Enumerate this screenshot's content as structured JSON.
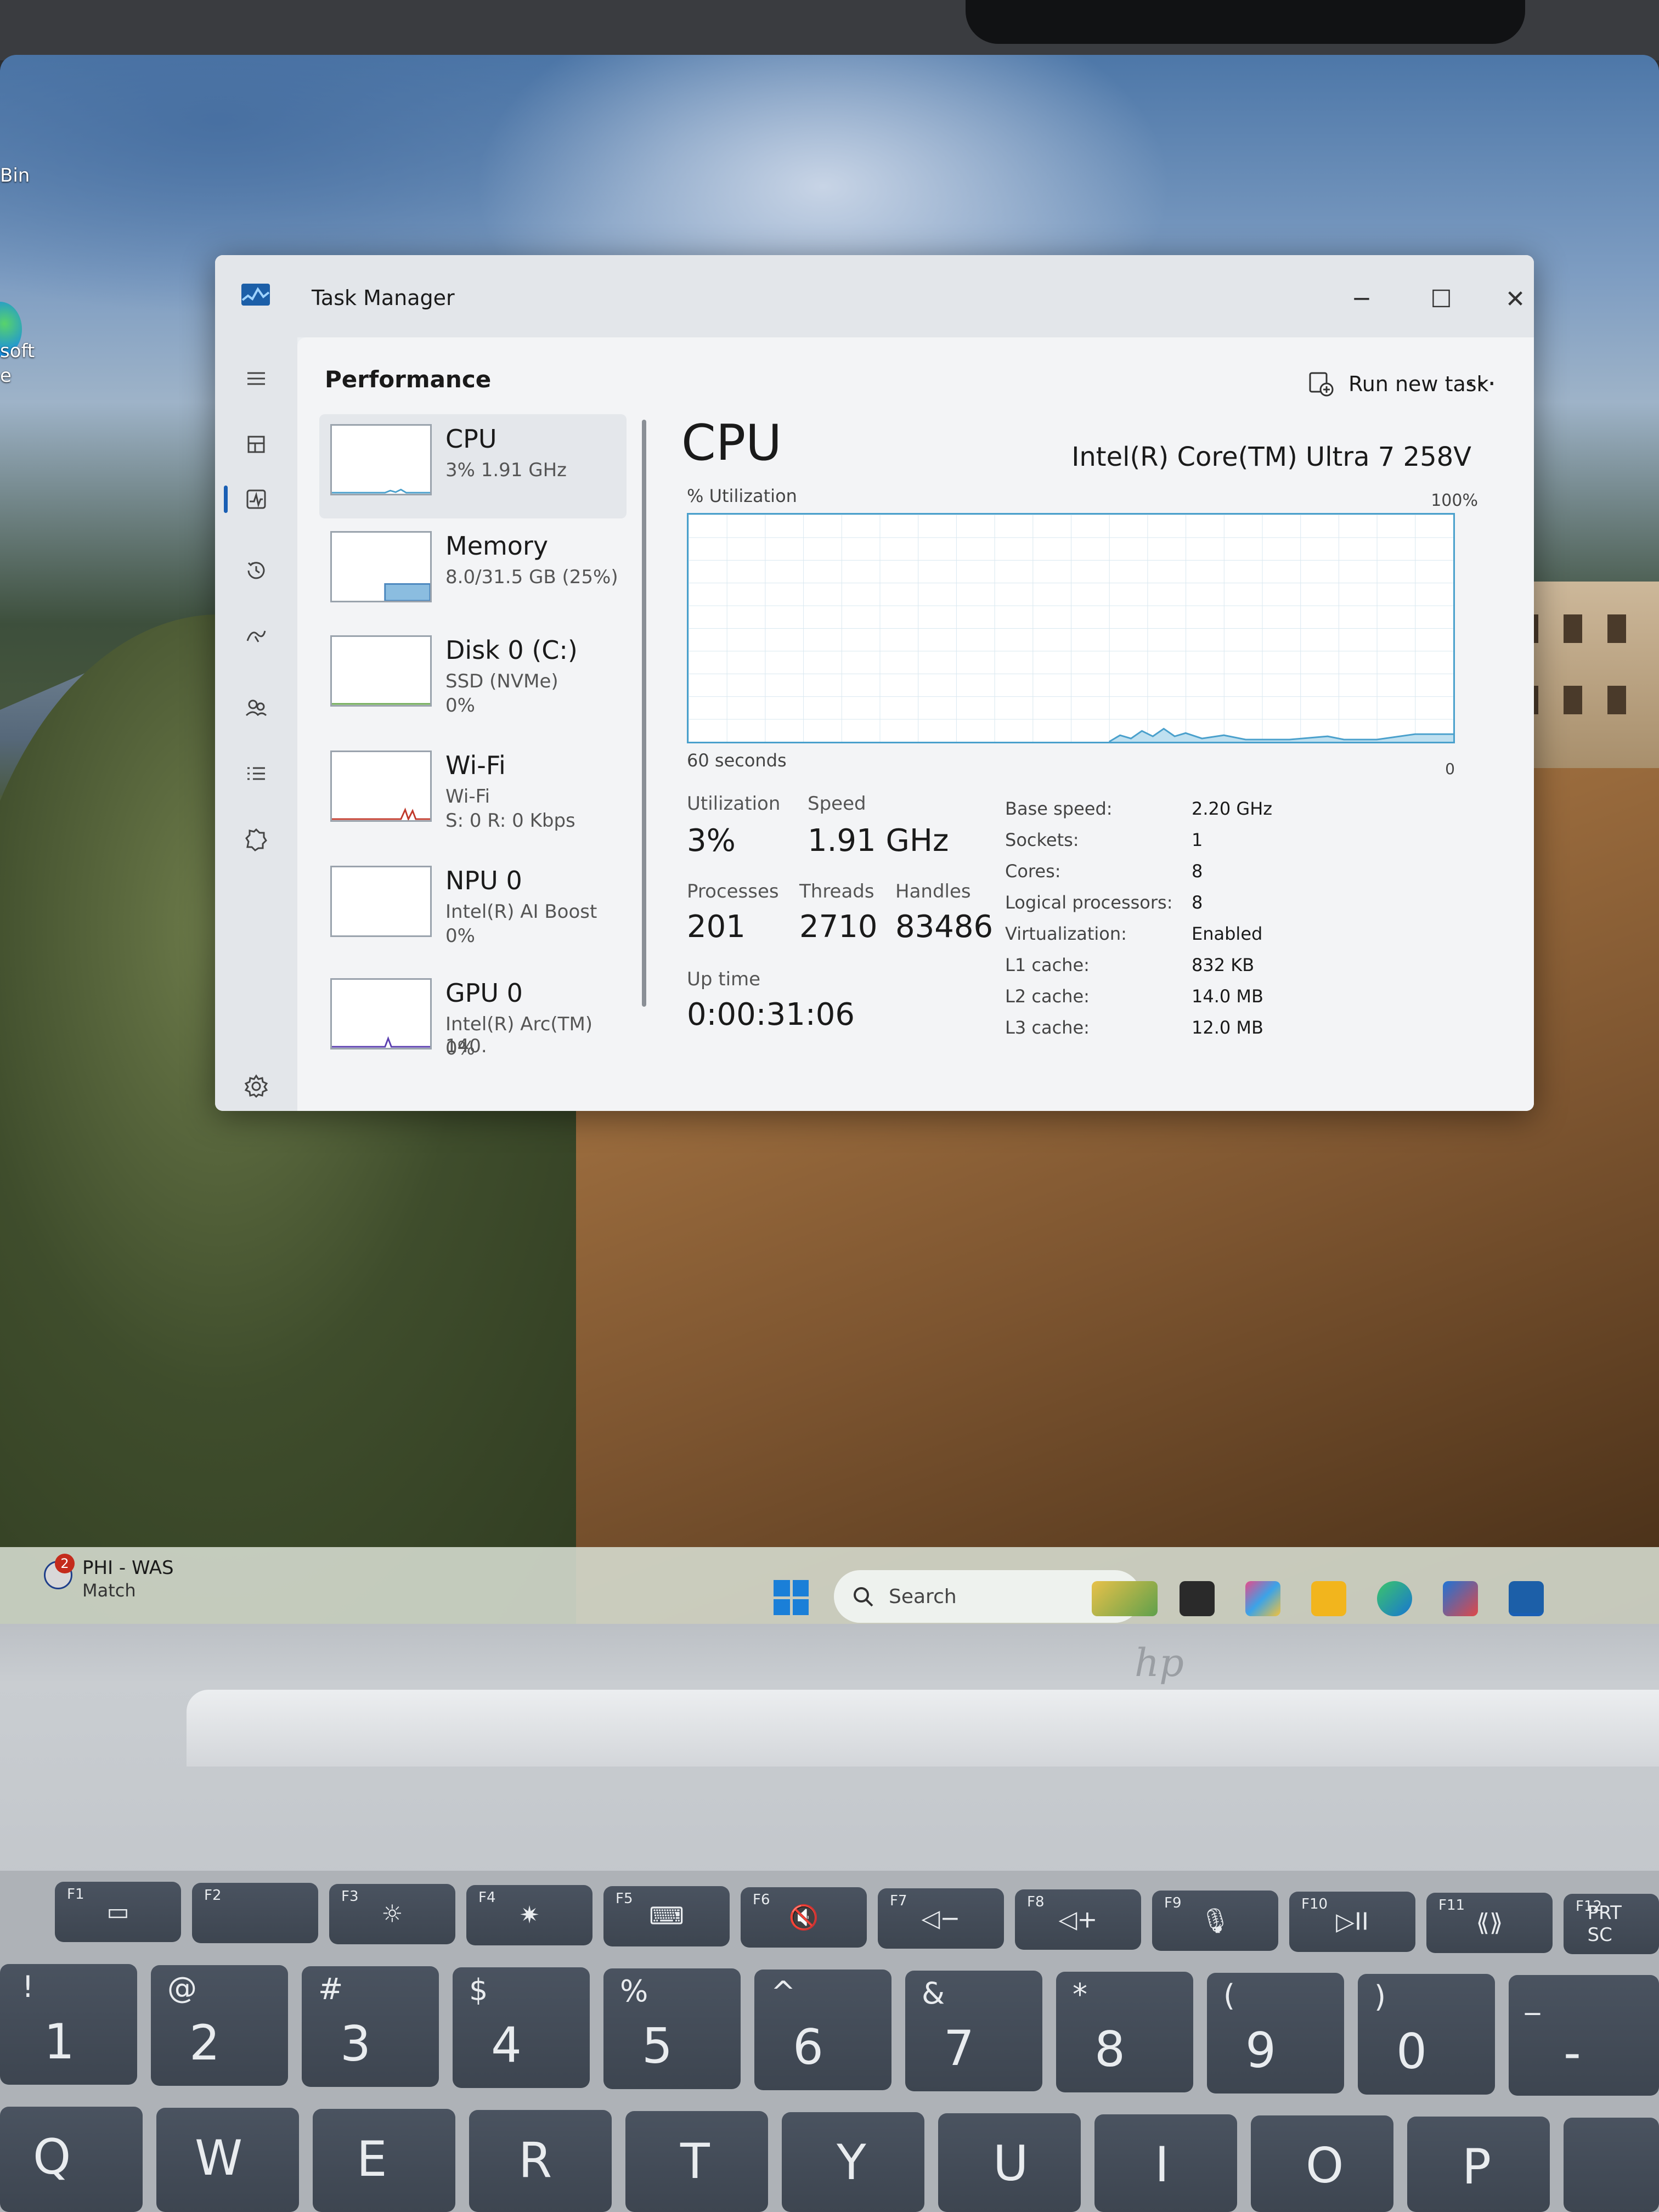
{
  "desktop": {
    "label_bin": "Bin",
    "label_soft": "soft",
    "label_e": "e"
  },
  "window": {
    "title": "Task Manager",
    "controls": {
      "minimize": "─",
      "maximize": "☐",
      "close": "✕"
    }
  },
  "toolbar": {
    "page_title": "Performance",
    "run_new_task": "Run new task",
    "more": "···"
  },
  "devices": [
    {
      "name": "CPU",
      "line1": "3%  1.91 GHz",
      "line2": ""
    },
    {
      "name": "Memory",
      "line1": "8.0/31.5 GB (25%)",
      "line2": ""
    },
    {
      "name": "Disk 0 (C:)",
      "line1": "SSD (NVMe)",
      "line2": "0%"
    },
    {
      "name": "Wi-Fi",
      "line1": "Wi-Fi",
      "line2": "S: 0 R: 0 Kbps"
    },
    {
      "name": "NPU 0",
      "line1": "Intel(R) AI Boost",
      "line2": "0%"
    },
    {
      "name": "GPU 0",
      "line1": "Intel(R) Arc(TM) 140.",
      "line2": "0%"
    }
  ],
  "detail": {
    "heading": "CPU",
    "model": "Intel(R) Core(TM) Ultra 7 258V",
    "graph_label": "% Utilization",
    "graph_max": "100%",
    "graph_window": "60 seconds",
    "graph_min": "0",
    "utilization_label": "Utilization",
    "utilization": "3%",
    "speed_label": "Speed",
    "speed": "1.91 GHz",
    "processes_label": "Processes",
    "processes": "201",
    "threads_label": "Threads",
    "threads": "2710",
    "handles_label": "Handles",
    "handles": "83486",
    "uptime_label": "Up time",
    "uptime": "0:00:31:06",
    "specs": [
      {
        "label": "Base speed:",
        "value": "2.20 GHz"
      },
      {
        "label": "Sockets:",
        "value": "1"
      },
      {
        "label": "Cores:",
        "value": "8"
      },
      {
        "label": "Logical processors:",
        "value": "8"
      },
      {
        "label": "Virtualization:",
        "value": "Enabled"
      },
      {
        "label": "L1 cache:",
        "value": "832 KB"
      },
      {
        "label": "L2 cache:",
        "value": "14.0 MB"
      },
      {
        "label": "L3 cache:",
        "value": "12.0 MB"
      }
    ]
  },
  "taskbar": {
    "badge_count": "2",
    "score_line1": "PHI - WAS",
    "score_line2": "Match",
    "search_placeholder": "Search"
  },
  "keyboard": {
    "fn_labels": [
      "F1",
      "F2",
      "F3",
      "F4",
      "F5",
      "F6",
      "F7",
      "F8",
      "F9",
      "F10",
      "F11",
      "F12"
    ],
    "fn_symbols": [
      "▭",
      "",
      "☼",
      "✷",
      "⌨",
      "🔇",
      "◁−",
      "◁+",
      "🎙",
      "▷II",
      "⟪⟫",
      "PRT SC"
    ],
    "number_keys": [
      {
        "top": "!",
        "main": "1"
      },
      {
        "top": "@",
        "main": "2"
      },
      {
        "top": "#",
        "main": "3"
      },
      {
        "top": "$",
        "main": "4"
      },
      {
        "top": "%",
        "main": "5"
      },
      {
        "top": "^",
        "main": "6"
      },
      {
        "top": "&",
        "main": "7"
      },
      {
        "top": "*",
        "main": "8"
      },
      {
        "top": "(",
        "main": "9"
      },
      {
        "top": ")",
        "main": "0"
      },
      {
        "top": "_",
        "main": "-"
      }
    ],
    "letter_keys": [
      "Q",
      "W",
      "E",
      "R",
      "T",
      "Y",
      "U",
      "I",
      "O",
      "P"
    ]
  },
  "colors": {
    "accent": "#1a5fb4",
    "graph_line": "#4aa0cc",
    "graph_fill": "#bfe0f0",
    "memory_fill": "#8bbde0"
  }
}
